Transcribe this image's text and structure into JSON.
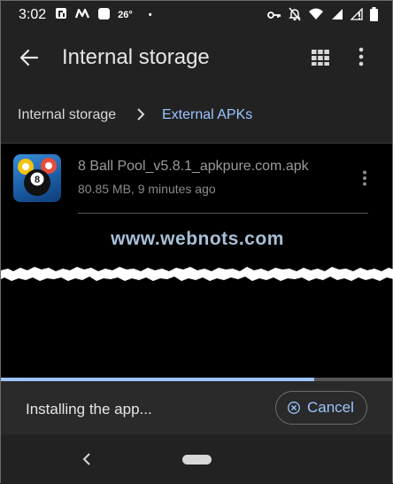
{
  "status_bar": {
    "time": "3:02",
    "notification_icons": [
      "fi-logo-icon",
      "m-logo-icon",
      "square-app-icon"
    ],
    "temperature": "26°",
    "dot": "•",
    "system_icons": [
      "key-icon",
      "bell-off-icon",
      "wifi-icon",
      "signal-icon",
      "signal-alert-icon",
      "battery-icon"
    ]
  },
  "toolbar": {
    "back_icon": "arrow-left-icon",
    "title": "Internal storage",
    "grid_icon": "grid-view-icon",
    "more_icon": "more-vert-icon"
  },
  "breadcrumb": {
    "items": [
      "Internal storage",
      "External APKs"
    ],
    "separator_icon": "chevron-right-icon"
  },
  "file": {
    "name": "8 Ball Pool_v5.8.1_apkpure.com.apk",
    "meta": "80.85 MB, 9 minutes ago",
    "icon": "8-ball-pool-app-icon",
    "more_icon": "more-vert-icon"
  },
  "watermark": "www.webnots.com",
  "install": {
    "text": "Installing the app...",
    "cancel_label": "Cancel",
    "progress": 0.8
  },
  "nav": {
    "back_icon": "nav-back-icon",
    "home_icon": "home-pill-icon"
  },
  "colors": {
    "accent": "#9cc4ff",
    "bar_background": "#222222",
    "install_bar_background": "#2a2a2a",
    "content_background": "#000000"
  }
}
